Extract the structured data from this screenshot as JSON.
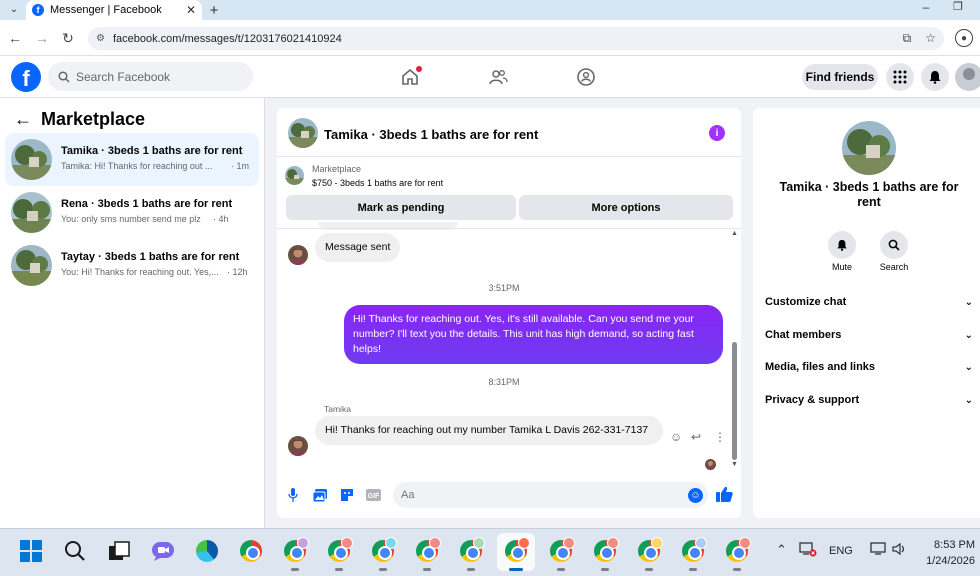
{
  "browser": {
    "tab_title": "Messenger | Facebook",
    "tab_close": "✕",
    "new_tab": "+",
    "url": "facebook.com/messages/t/1203176021410924"
  },
  "fb": {
    "logo": "f",
    "search_placeholder": "Search Facebook",
    "find_friends": "Find friends"
  },
  "left": {
    "title": "Marketplace",
    "conversations": [
      {
        "name": "Tamika · 3beds 1 baths are for rent",
        "preview": "Tamika: Hi! Thanks for reaching out ...",
        "time": "· 1m"
      },
      {
        "name": "Rena · 3beds 1 baths are for rent",
        "preview": "You: only sms number send me plz",
        "time": "· 4h"
      },
      {
        "name": "Taytay · 3beds 1 baths are for rent",
        "preview": "You: Hi! Thanks for reaching out. Yes,...",
        "time": "· 12h"
      }
    ]
  },
  "chat": {
    "title": "Tamika · 3beds 1 baths are for rent",
    "marketplace_label": "Marketplace",
    "item": "$750 - 3beds 1 baths are for rent",
    "mark_pending": "Mark as pending",
    "more_options": "More options",
    "msg_sent": "Message sent",
    "time1": "3:51PM",
    "outgoing": "Hi! Thanks for reaching out. Yes, it's still available. Can you send me your number? I'll text you the details. This unit has high demand, so acting fast helps!",
    "time2": "8:31PM",
    "sender": "Tamika",
    "incoming": "Hi! Thanks for reaching out my number Tamika L Davis 262-331-7137",
    "composer_placeholder": "Aa"
  },
  "right": {
    "title": "Tamika · 3beds 1 baths are for rent",
    "mute": "Mute",
    "search": "Search",
    "sections": [
      "Customize chat",
      "Chat members",
      "Media, files and links",
      "Privacy & support"
    ]
  },
  "taskbar": {
    "lang": "ENG",
    "time": "8:53 PM",
    "date": "1/24/2026"
  },
  "colors": {
    "fb_blue": "#0866ff",
    "outgoing_bubble": "#7b2ff7",
    "active_conversation": "#ebf5ff"
  }
}
